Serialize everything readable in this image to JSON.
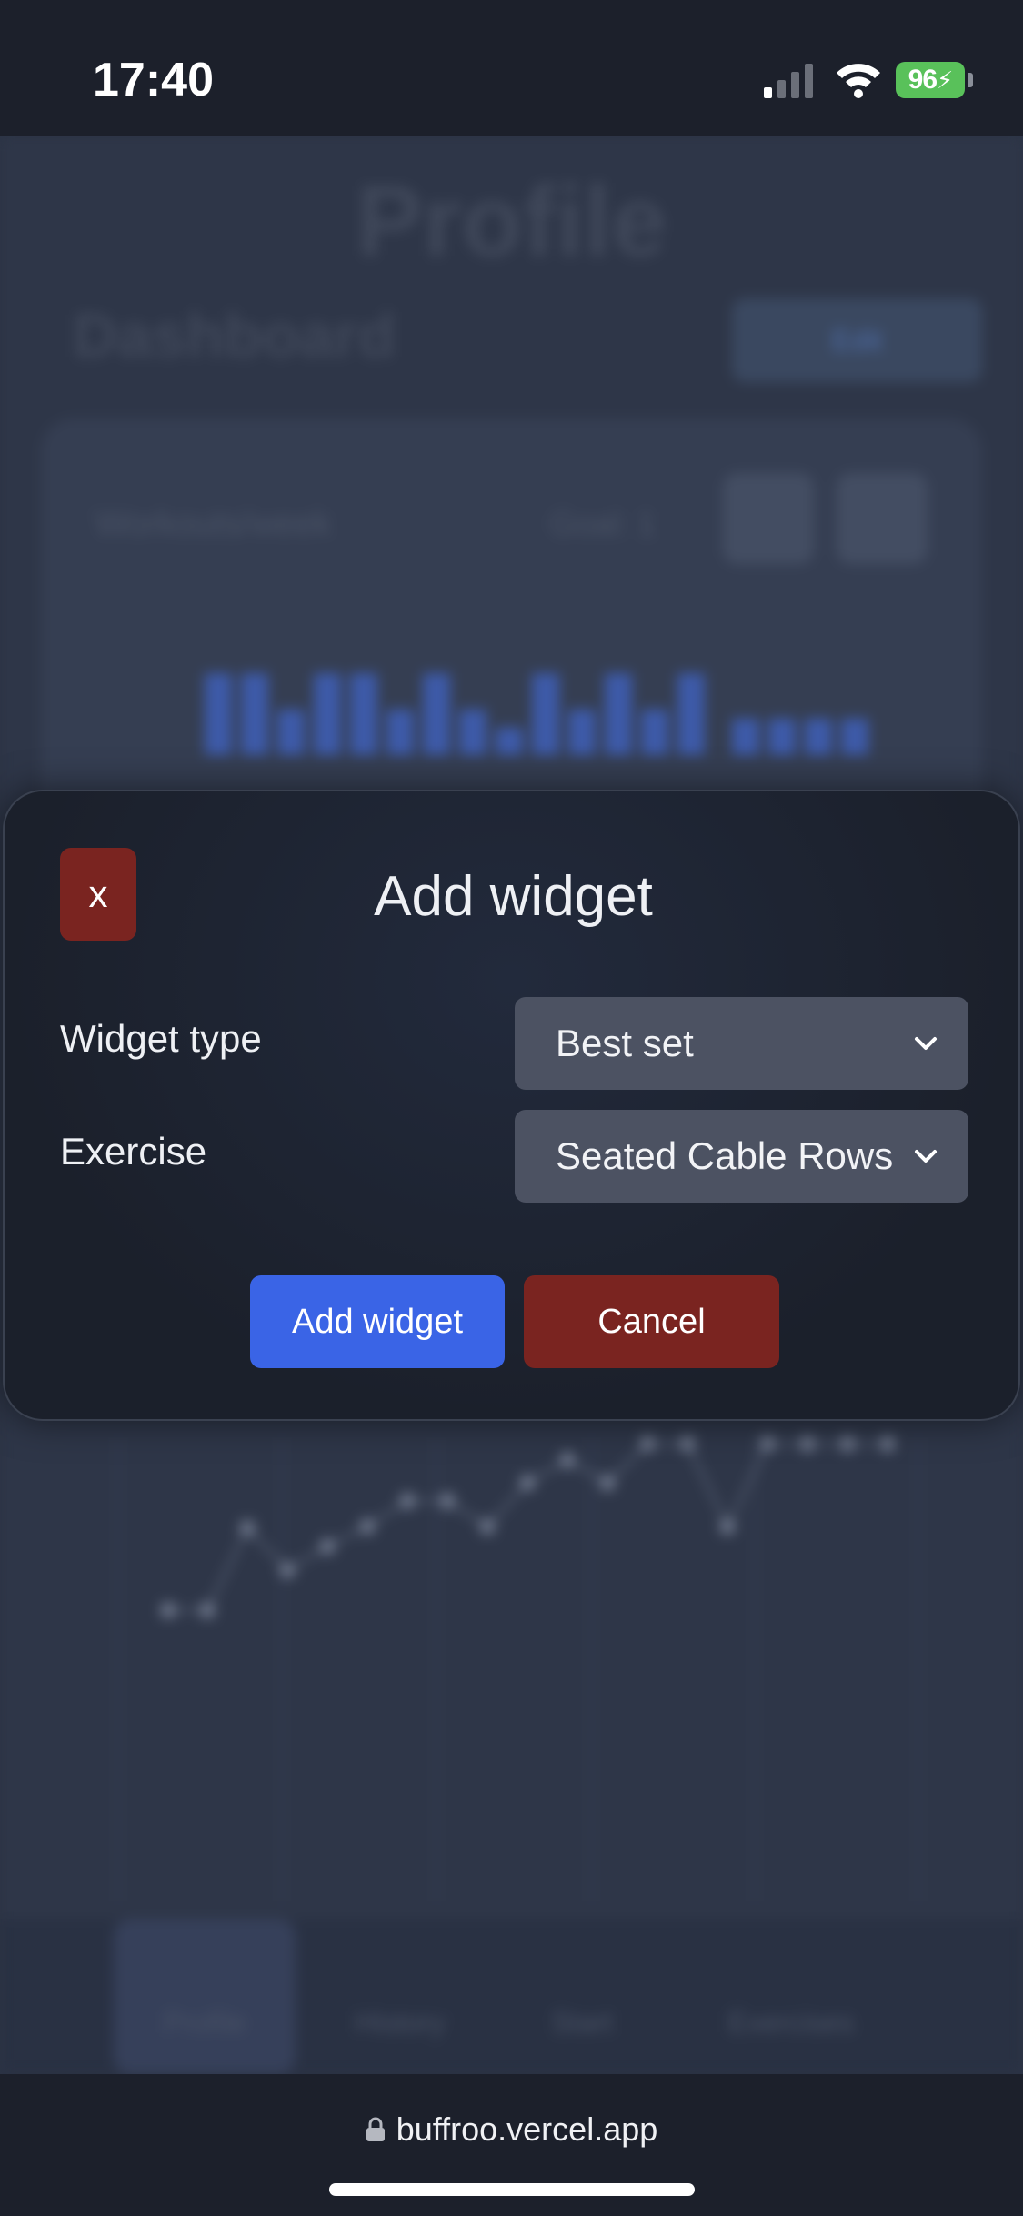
{
  "status_bar": {
    "time": "17:40",
    "battery": "96"
  },
  "background": {
    "page_title": "Profile",
    "dashboard_heading": "Dashboard",
    "edit_button": "Edit",
    "card_label": "Workouts/week",
    "goal_label": "Goal: 1",
    "nav_items": [
      "Profile",
      "History",
      "Start",
      "Exercises"
    ]
  },
  "modal": {
    "close_label": "x",
    "title": "Add widget",
    "fields": [
      {
        "label": "Widget type",
        "value": "Best set"
      },
      {
        "label": "Exercise",
        "value": "Seated Cable Rows"
      }
    ],
    "add_button": "Add widget",
    "cancel_button": "Cancel"
  },
  "browser": {
    "url": "buffroo.vercel.app"
  },
  "colors": {
    "primary": "#3a64e6",
    "danger": "#7a2420",
    "modal_bg": "#1c212d",
    "select_bg": "#4c5262",
    "battery": "#59c15a"
  }
}
